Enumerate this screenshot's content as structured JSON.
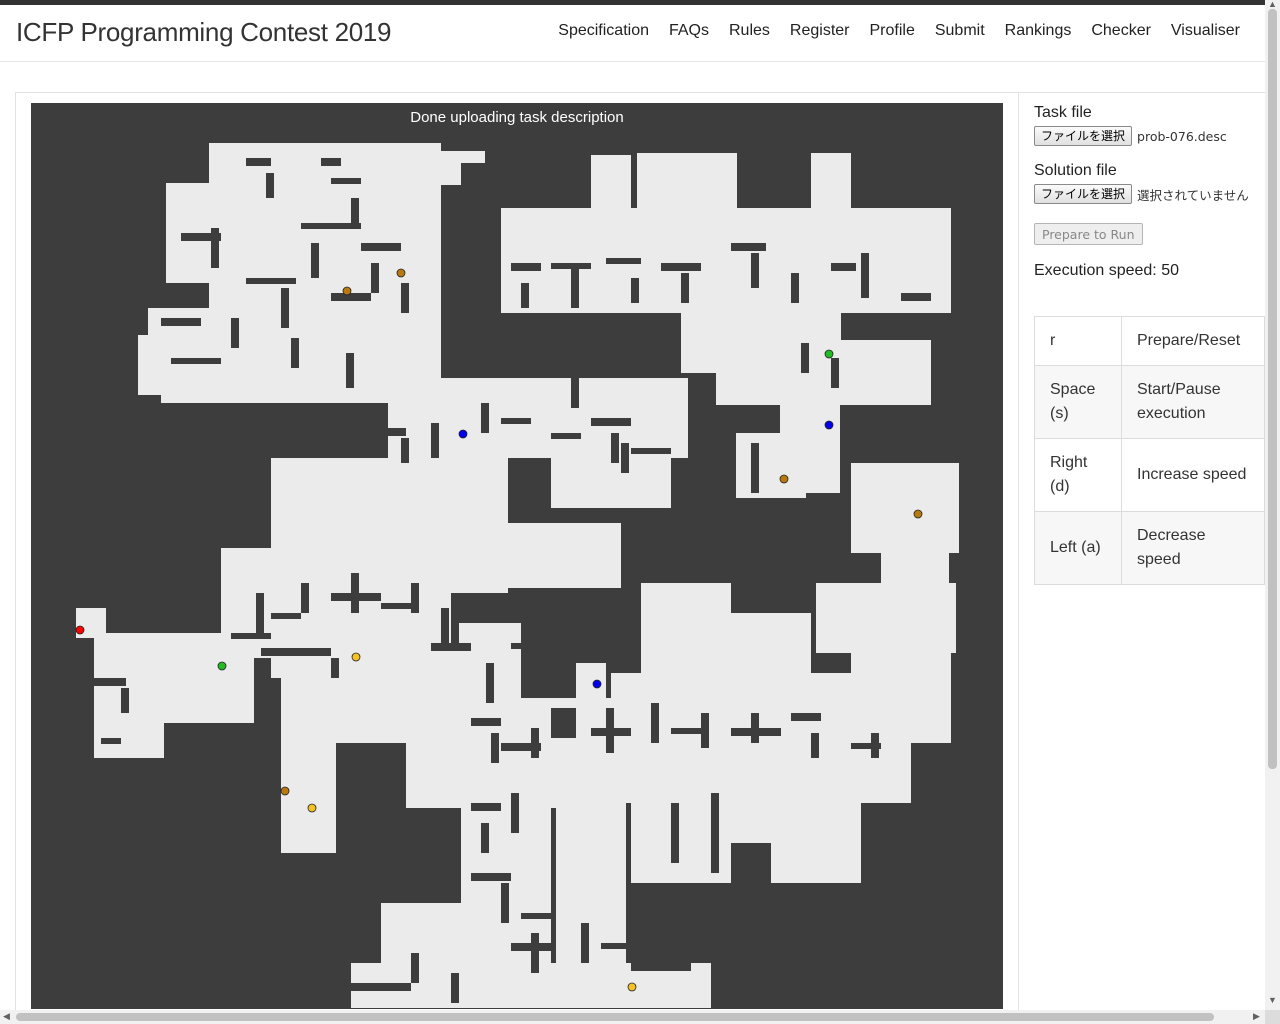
{
  "brand": "ICFP Programming Contest 2019",
  "nav": [
    "Specification",
    "FAQs",
    "Rules",
    "Register",
    "Profile",
    "Submit",
    "Rankings",
    "Checker",
    "Visualiser"
  ],
  "canvas": {
    "status": "Done uploading task description",
    "colors": {
      "background": "#3d3d3d",
      "floor": "#ebebeb"
    },
    "markers": [
      {
        "color": "#ff0000",
        "kind": "worker"
      },
      {
        "color": "#22bb22",
        "kind": "booster-clone"
      },
      {
        "color": "#22bb22",
        "kind": "booster-clone"
      },
      {
        "color": "#0000ee",
        "kind": "booster-teleport"
      },
      {
        "color": "#0000ee",
        "kind": "booster-teleport"
      },
      {
        "color": "#0000ee",
        "kind": "booster-teleport"
      },
      {
        "color": "#b87a10",
        "kind": "booster-manipulator"
      },
      {
        "color": "#b87a10",
        "kind": "booster-manipulator"
      },
      {
        "color": "#b87a10",
        "kind": "booster-manipulator"
      },
      {
        "color": "#b87a10",
        "kind": "booster-manipulator"
      },
      {
        "color": "#b87a10",
        "kind": "booster-manipulator"
      },
      {
        "color": "#f5c226",
        "kind": "booster-wheels"
      },
      {
        "color": "#f5c226",
        "kind": "booster-wheels"
      },
      {
        "color": "#f5c226",
        "kind": "booster-wheels"
      }
    ]
  },
  "sidebar": {
    "task_label": "Task file",
    "task_button": "ファイルを選択",
    "task_file": "prob-076.desc",
    "solution_label": "Solution file",
    "solution_button": "ファイルを選択",
    "solution_file": "選択されていません",
    "prepare_button": "Prepare to Run",
    "speed_text": "Execution speed: 50"
  },
  "keys": [
    {
      "key": "r",
      "action": "Prepare/Reset"
    },
    {
      "key": "Space (s)",
      "action": "Start/Pause execution"
    },
    {
      "key": "Right (d)",
      "action": "Increase speed"
    },
    {
      "key": "Left (a)",
      "action": "Decrease speed"
    }
  ]
}
